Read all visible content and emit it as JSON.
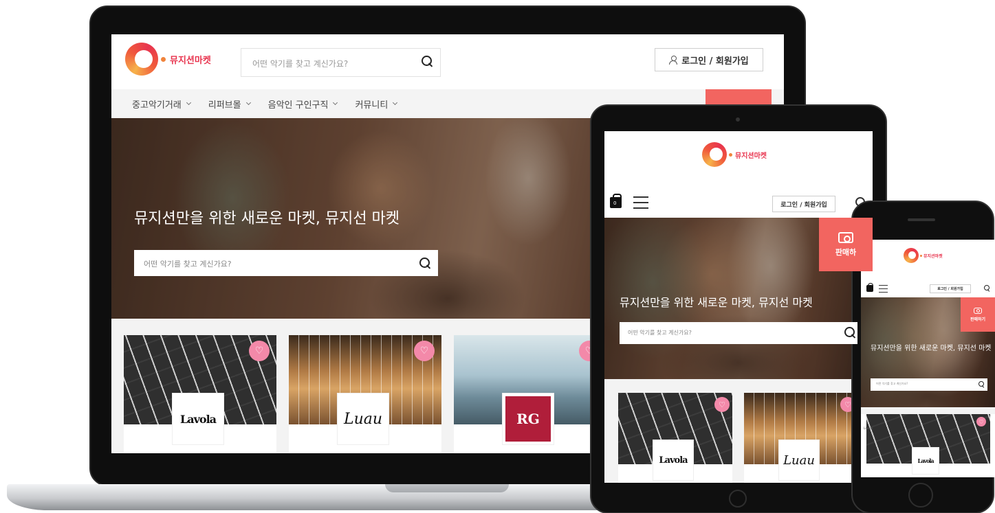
{
  "brand": {
    "name": "뮤지션마켓",
    "colors": {
      "primary": "#e8344e",
      "accent": "#f26560",
      "heart": "#f389a9"
    }
  },
  "laptop": {
    "search_placeholder": "어떤 악기를 찾고 계신가요?",
    "login_label": "로그인 / 회원가입",
    "nav": [
      {
        "label": "중고악기거래"
      },
      {
        "label": "리퍼브몰"
      },
      {
        "label": "음악인 구인구직"
      },
      {
        "label": "커뮤니티"
      }
    ],
    "hero": {
      "headline": "뮤지션만을 위한 새로운 마켓, 뮤지선 마켓",
      "search_placeholder": "어떤 악기를 찾고 계신가요?"
    },
    "products": [
      {
        "brand": "Lavola",
        "photo": "guitar-fretboard"
      },
      {
        "brand": "Luau",
        "photo": "ukulele"
      },
      {
        "brand": "RG",
        "photo": "mountain-hikers"
      }
    ]
  },
  "tablet": {
    "login_label": "로그인 / 회원가입",
    "cart_count": "0",
    "sell_label": "판매하",
    "hero": {
      "headline": "뮤지션만을 위한 새로운 마켓, 뮤지선 마켓",
      "search_placeholder": "어떤 악기를 찾고 계신가요?"
    },
    "products": [
      {
        "brand": "Lavola"
      },
      {
        "brand": "Luau"
      }
    ]
  },
  "phone": {
    "login_label": "로그인 / 회원가입",
    "sell_label": "판매하기",
    "hero": {
      "headline": "뮤지션만을 위한 새로운 마켓, 뮤지선 마켓",
      "search_placeholder": "어떤 악기를 찾고 계신가요?"
    },
    "products": [
      {
        "label": "Lavola",
        "brand": "Lavola"
      }
    ]
  },
  "icons": [
    "search-icon",
    "user-icon",
    "chevron-down-icon",
    "heart-icon",
    "shopping-bag-icon",
    "hamburger-menu-icon",
    "camera-icon"
  ]
}
